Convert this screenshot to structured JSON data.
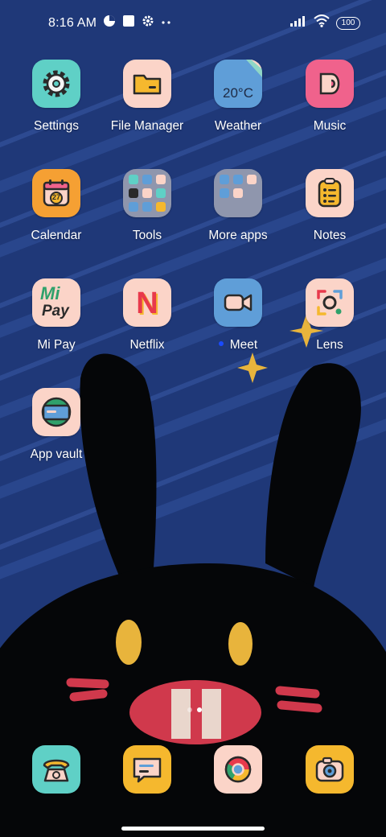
{
  "status_bar": {
    "time": "8:16 AM",
    "battery": "100"
  },
  "apps": [
    {
      "label": "Settings",
      "icon": "settings-gear-icon"
    },
    {
      "label": "File Manager",
      "icon": "folder-icon"
    },
    {
      "label": "Weather",
      "icon": "weather-icon",
      "temp": "20°C"
    },
    {
      "label": "Music",
      "icon": "music-icon"
    },
    {
      "label": "Calendar",
      "icon": "calendar-icon",
      "day": "27"
    },
    {
      "label": "Tools",
      "icon": "folder-tools-icon"
    },
    {
      "label": "More apps",
      "icon": "folder-more-apps-icon"
    },
    {
      "label": "Notes",
      "icon": "notes-icon"
    },
    {
      "label": "Mi Pay",
      "icon": "mi-pay-icon",
      "logo_top": "Mi",
      "logo_bottom": "Pay"
    },
    {
      "label": "Netflix",
      "icon": "netflix-icon",
      "logo": "N"
    },
    {
      "label": "Meet",
      "icon": "meet-video-icon"
    },
    {
      "label": "Lens",
      "icon": "lens-icon"
    },
    {
      "label": "App vault",
      "icon": "app-vault-icon"
    }
  ],
  "dock": [
    {
      "name": "phone",
      "icon": "phone-icon"
    },
    {
      "name": "messaging",
      "icon": "message-icon"
    },
    {
      "name": "chrome",
      "icon": "chrome-icon"
    },
    {
      "name": "camera",
      "icon": "camera-icon"
    }
  ],
  "colors": {
    "background": "#1d3573",
    "settings": "#5fd0c6",
    "file_manager": "#fbd4c8",
    "weather": "#5f9ed8",
    "music": "#f0628c",
    "calendar": "#f5a033",
    "folder": "#8f96ad",
    "notes": "#fbd4c8",
    "mi_pay": "#fbd4c8",
    "netflix": "#fbd4c8",
    "meet": "#5f9ed8",
    "lens": "#fbd4c8",
    "app_vault": "#fbd4c8",
    "dock_phone": "#5fd0c6",
    "dock_message": "#f5b82e",
    "dock_chrome": "#fbd4c8",
    "dock_camera": "#f5b82e"
  }
}
